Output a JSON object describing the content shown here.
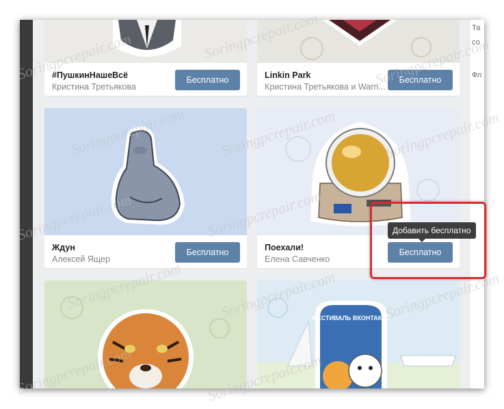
{
  "watermark": "Soringpcrepair.com",
  "side_fragments": [
    "Та",
    "со",
    "Фл"
  ],
  "tooltip": "Добавить бесплатно",
  "packs": [
    {
      "name": "#ПушкинНашеВсё",
      "author": "Кристина Третьякова",
      "button": "Бесплатно"
    },
    {
      "name": "Linkin Park",
      "author": "Кристина Третьякова и Warn...",
      "button": "Бесплатно"
    },
    {
      "name": "Ждун",
      "author": "Алексей Ящер",
      "button": "Бесплатно"
    },
    {
      "name": "Поехали!",
      "author": "Елена Савченко",
      "button": "Бесплатно"
    }
  ],
  "badge_text": "ФЕСТИВАЛЬ ВКОНТАКТЕ",
  "colors": {
    "button": "#5e81a8",
    "highlight": "#d62d2d",
    "page_bg": "#edeef0"
  }
}
